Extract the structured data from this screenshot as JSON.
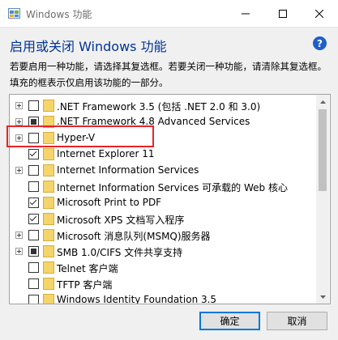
{
  "window": {
    "title": "Windows 功能",
    "controls": [
      "minimize",
      "maximize",
      "close"
    ]
  },
  "header": {
    "heading": "启用或关闭 Windows 功能",
    "help_label": "?",
    "description": "若要启用一种功能，请选择其复选框。若要关闭一种功能，请清除其复选框。填充的框表示仅启用该功能的一部分。"
  },
  "features": [
    {
      "label": ".NET Framework 3.5 (包括 .NET 2.0 和 3.0)",
      "expandable": true,
      "state": "unchecked"
    },
    {
      "label": ".NET Framework 4.8 Advanced Services",
      "expandable": true,
      "state": "partial"
    },
    {
      "label": "Hyper-V",
      "expandable": true,
      "state": "unchecked",
      "highlighted": true
    },
    {
      "label": "Internet Explorer 11",
      "expandable": false,
      "state": "checked"
    },
    {
      "label": "Internet Information Services",
      "expandable": true,
      "state": "unchecked"
    },
    {
      "label": "Internet Information Services 可承载的 Web 核心",
      "expandable": false,
      "state": "unchecked"
    },
    {
      "label": "Microsoft Print to PDF",
      "expandable": false,
      "state": "checked"
    },
    {
      "label": "Microsoft XPS 文档写入程序",
      "expandable": false,
      "state": "checked"
    },
    {
      "label": "Microsoft 消息队列(MSMQ)服务器",
      "expandable": true,
      "state": "unchecked"
    },
    {
      "label": "SMB 1.0/CIFS 文件共享支持",
      "expandable": true,
      "state": "partial"
    },
    {
      "label": "Telnet 客户端",
      "expandable": false,
      "state": "unchecked"
    },
    {
      "label": "TFTP 客户端",
      "expandable": false,
      "state": "unchecked"
    },
    {
      "label": "Windows Identity Foundation 3.5",
      "expandable": false,
      "state": "unchecked"
    }
  ],
  "buttons": {
    "ok": "确定",
    "cancel": "取消"
  },
  "colors": {
    "heading": "#003399",
    "highlight": "#e8232a",
    "folder": "#f4d46b",
    "accent": "#0078d7"
  }
}
